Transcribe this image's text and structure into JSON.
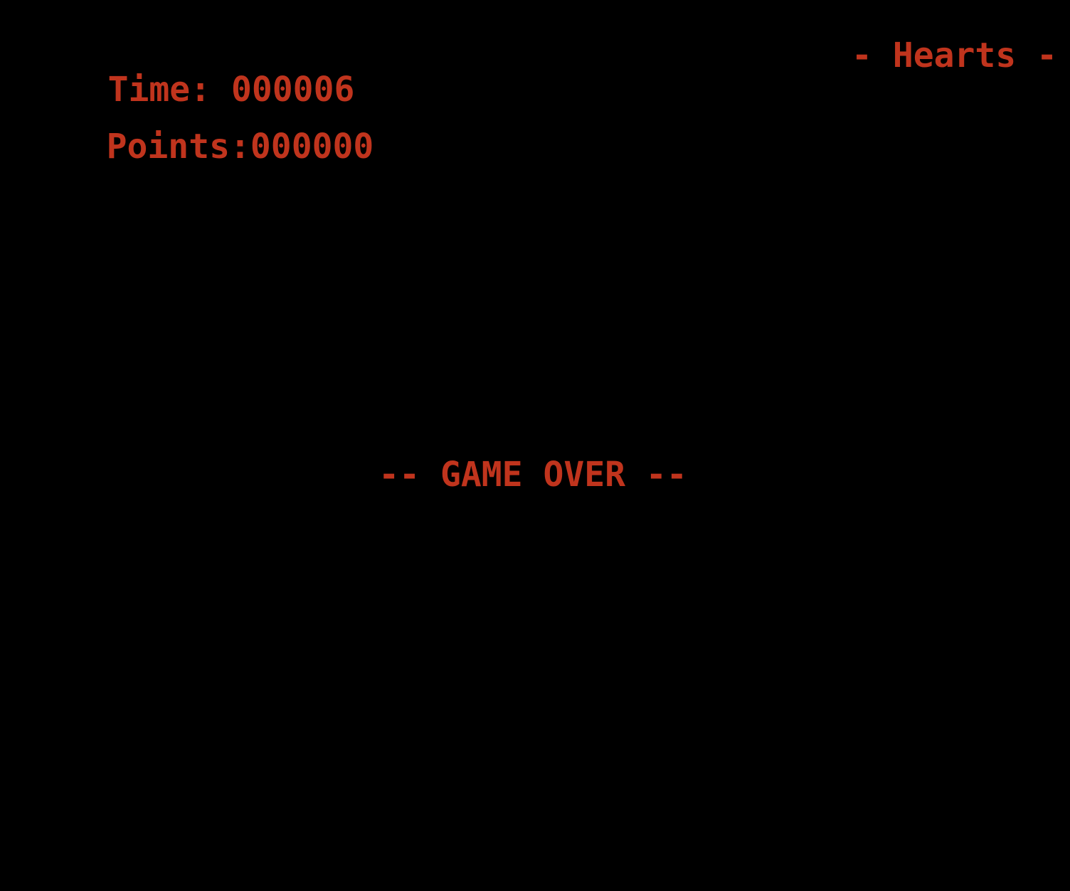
{
  "hud": {
    "time_label": "Time: ",
    "time_value": "000006",
    "points_label": "Points:",
    "points_value": "000000",
    "hearts_label": "- Hearts -"
  },
  "status": {
    "message": "-- GAME OVER --"
  },
  "colors": {
    "background": "#000000",
    "text": "#c0341d"
  }
}
